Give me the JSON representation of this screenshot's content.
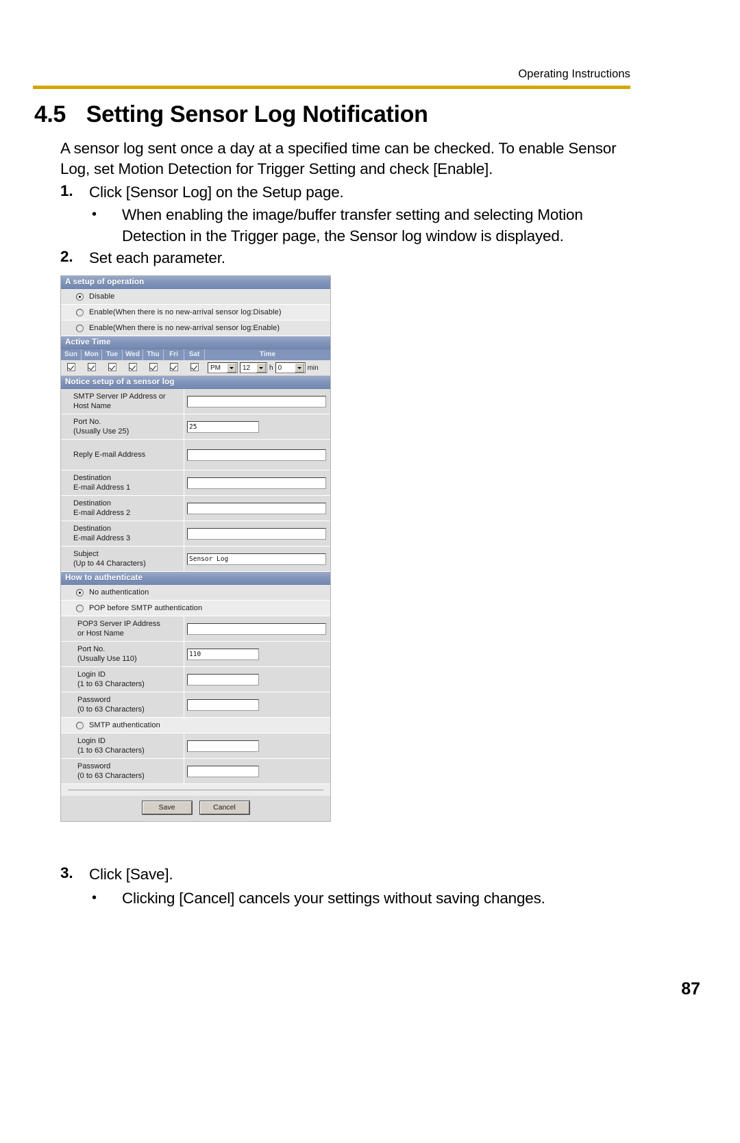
{
  "header": {
    "running_head": "Operating Instructions",
    "rule_color": "#d4a600"
  },
  "title": {
    "number": "4.5",
    "text": "Setting Sensor Log Notification"
  },
  "intro": "A sensor log sent once a day at a specified time can be checked. To enable Sensor Log, set Motion Detection for Trigger Setting and check [Enable].",
  "steps": {
    "step1_num": "1.",
    "step1_text": "Click [Sensor Log] on the Setup page.",
    "step1_bullet": "When enabling the image/buffer transfer setting and selecting Motion Detection in the Trigger page, the Sensor log window is displayed.",
    "step2_num": "2.",
    "step2_text": "Set each parameter.",
    "step3_num": "3.",
    "step3_text": "Click [Save].",
    "step3_bullet": "Clicking [Cancel] cancels your settings without saving changes."
  },
  "screenshot": {
    "section_operation": {
      "title": "A setup of operation",
      "options": [
        {
          "label": "Disable",
          "selected": true
        },
        {
          "label": "Enable(When there is no new-arrival sensor log:Disable)",
          "selected": false
        },
        {
          "label": "Enable(When there is no new-arrival sensor log:Enable)",
          "selected": false
        }
      ]
    },
    "section_active_time": {
      "title": "Active Time",
      "day_headers": [
        "Sun",
        "Mon",
        "Tue",
        "Wed",
        "Thu",
        "Fri",
        "Sat"
      ],
      "time_header": "Time",
      "days_checked": [
        true,
        true,
        true,
        true,
        true,
        true,
        true
      ],
      "ampm": "PM",
      "hour": "12",
      "hour_unit": "h",
      "minute": "0",
      "minute_unit": "min"
    },
    "section_notice": {
      "title": "Notice setup of a sensor log",
      "fields": [
        {
          "label_line1": "SMTP Server IP Address or",
          "label_line2": "Host Name",
          "value": ""
        },
        {
          "label_line1": "Port No.",
          "label_line2": "(Usually Use 25)",
          "value": "25"
        },
        {
          "label_line1": "Reply E-mail Address",
          "label_line2": "",
          "value": ""
        },
        {
          "label_line1": "Destination",
          "label_line2": "E-mail Address 1",
          "value": ""
        },
        {
          "label_line1": "Destination",
          "label_line2": "E-mail Address 2",
          "value": ""
        },
        {
          "label_line1": "Destination",
          "label_line2": "E-mail Address 3",
          "value": ""
        },
        {
          "label_line1": "Subject",
          "label_line2": "(Up to 44 Characters)",
          "value": "Sensor Log"
        }
      ]
    },
    "section_auth": {
      "title": "How to authenticate",
      "option_none": {
        "label": "No authentication",
        "selected": true
      },
      "option_pop": {
        "label": "POP before SMTP authentication",
        "selected": false
      },
      "pop_fields": [
        {
          "label_line1": "POP3 Server IP Address",
          "label_line2": "or Host Name",
          "value": ""
        },
        {
          "label_line1": "Port No.",
          "label_line2": "(Usually Use 110)",
          "value": "110"
        },
        {
          "label_line1": "Login ID",
          "label_line2": "(1 to 63 Characters)",
          "value": ""
        },
        {
          "label_line1": "Password",
          "label_line2": "(0 to 63 Characters)",
          "value": ""
        }
      ],
      "option_smtp": {
        "label": "SMTP authentication",
        "selected": false
      },
      "smtp_fields": [
        {
          "label_line1": "Login ID",
          "label_line2": "(1 to 63 Characters)",
          "value": ""
        },
        {
          "label_line1": "Password",
          "label_line2": "(0 to 63 Characters)",
          "value": ""
        }
      ]
    },
    "buttons": {
      "save": "Save",
      "cancel": "Cancel"
    }
  },
  "page_number": "87"
}
